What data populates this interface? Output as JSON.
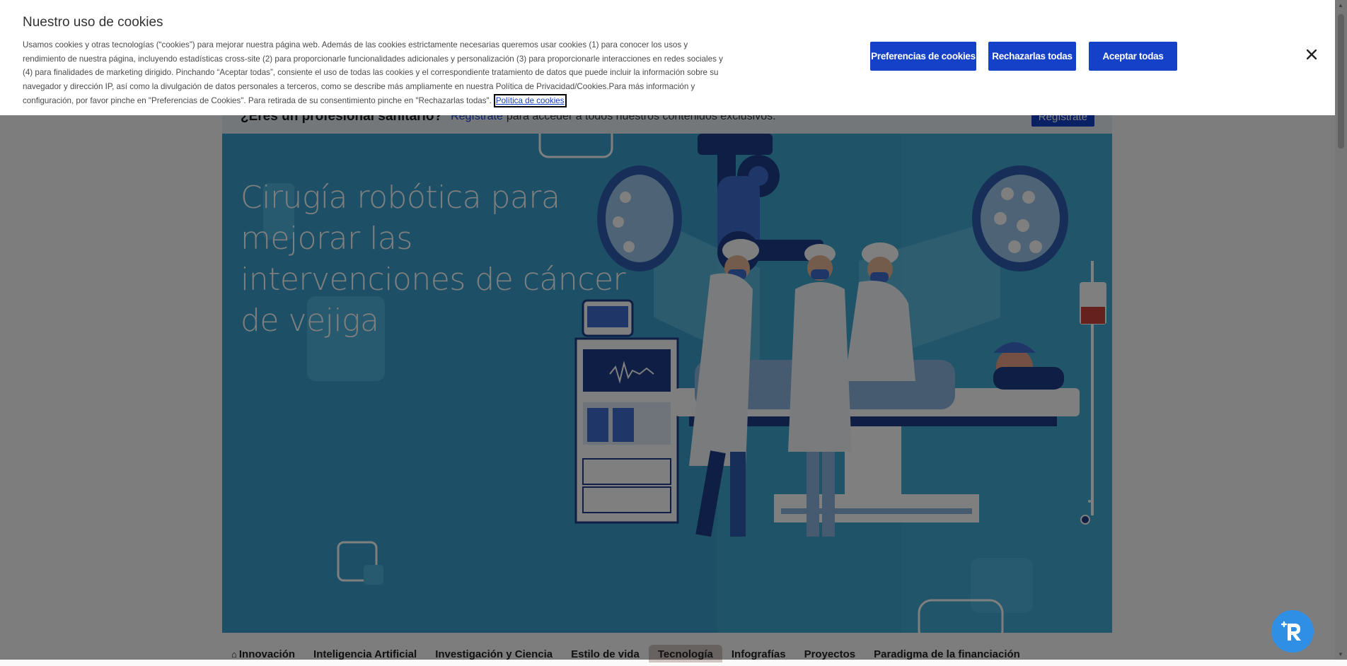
{
  "cookie_banner": {
    "title": "Nuestro uso de cookies",
    "text": "Usamos cookies y otras tecnologías (“cookies”) para mejorar nuestra página web. Además de las cookies estrictamente necesarias queremos usar cookies (1) para conocer los usos y rendimiento de nuestra página, incluyendo estadísticas cross-site (2) para proporcionarle funcionalidades adicionales y personalización (3) para proporcionarle interacciones en redes sociales y (4) para finalidades de marketing dirigido. Pinchando “Aceptar todas”, consiente el uso de todas las cookies y el correspondiente tratamiento de datos que puede incluir la información sobre su navegador y dirección IP, así como la divulgación de datos personales a terceros, como se describe más ampliamente en nuestra Política de Privacidad/Cookies.Para más información y configuración, por favor pinche en \"Preferencias de Cookies\". Para retirada de su consentimiento pinche en \"Rechazarlas todas\".",
    "policy_link": "Política de cookies",
    "preferences_button": "Preferencias de cookies",
    "reject_button": "Rechazarlas todas",
    "accept_button": "Aceptar todas",
    "close_icon": "close-icon"
  },
  "pro_bar": {
    "question": "¿Eres un profesional sanitario?",
    "link": "Regístrate",
    "rest": "para acceder a todos nuestros contenidos exclusivos.",
    "button": "Regístrate"
  },
  "hero": {
    "title": "Cirugía robótica para mejorar las intervenciones de cáncer de vejiga"
  },
  "nav": {
    "home_icon": "home-icon",
    "items": [
      "Innovación",
      "Inteligencia Artificial",
      "Investigación y Ciencia",
      "Estilo de vida",
      "Tecnología",
      "Infografías",
      "Proyectos",
      "Paradigma de la financiación"
    ],
    "active_index": 4
  },
  "colors": {
    "brand_blue": "#1441c8",
    "hero_bg": "#3aa1cc",
    "fab": "#2f8fe4"
  },
  "fab": {
    "icon": "robot-assistant-icon"
  }
}
